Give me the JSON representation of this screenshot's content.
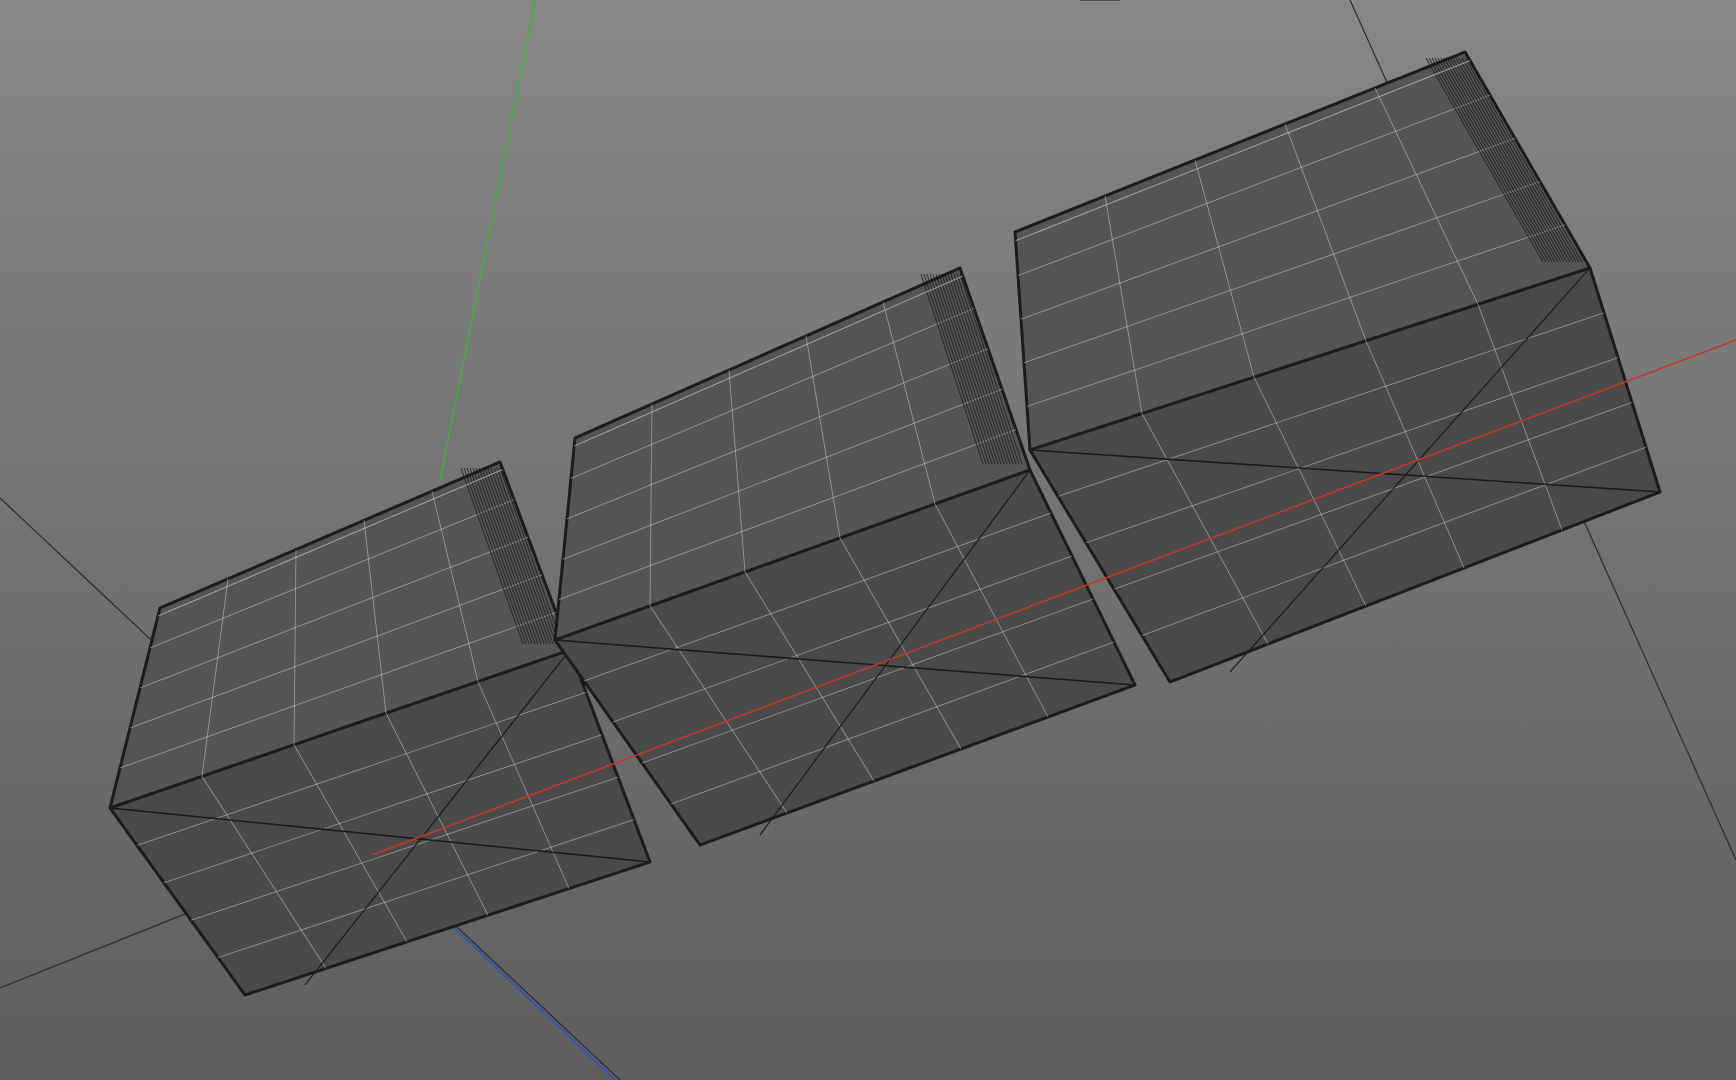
{
  "viewport": {
    "background_top": "#878787",
    "background_bottom": "#5e5e5e",
    "label": ""
  },
  "axes": {
    "x_color": "#c0392b",
    "y_color": "#3db23d",
    "z_color": "#3050c8",
    "grid_color": "#2c2c2c"
  },
  "mesh": {
    "face_color": "#4a4a4a",
    "edge_color": "#1c1c1c",
    "wire_color": "#d8d8d8",
    "object_count": 3
  }
}
